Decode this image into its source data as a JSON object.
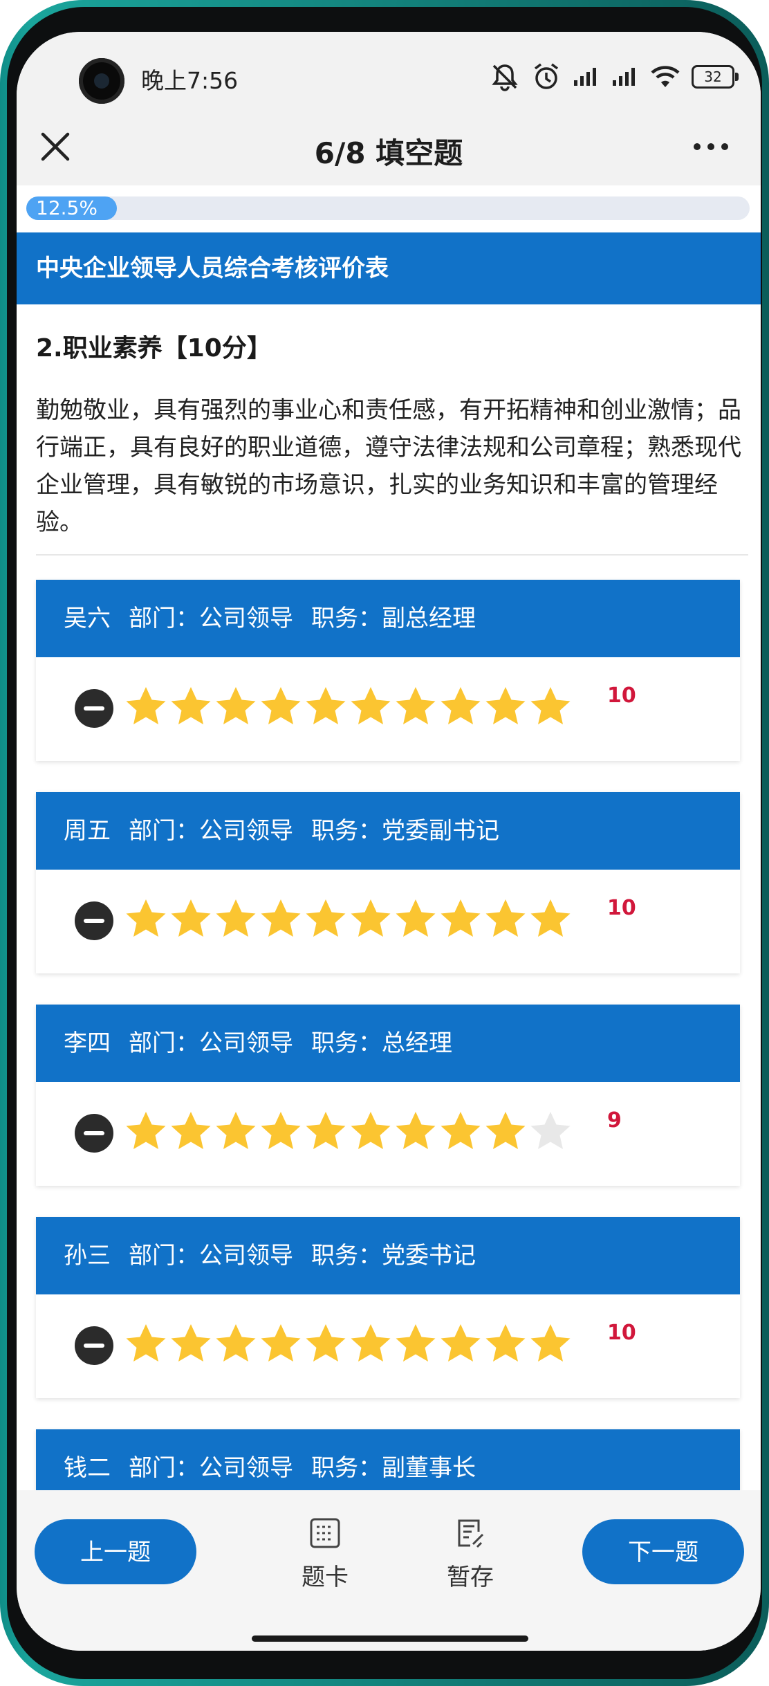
{
  "status_bar": {
    "time": "晚上7:56",
    "battery": "32",
    "icons": [
      "mute-icon",
      "alarm-icon",
      "signal-icon",
      "signal-icon",
      "wifi-icon",
      "battery-icon"
    ]
  },
  "nav": {
    "title": "6/8 填空题",
    "close_icon": "close-icon",
    "more_icon": "more-icon"
  },
  "progress": {
    "label": "12.5%",
    "value": 0.125
  },
  "section": {
    "header": "中央企业领导人员综合考核评价表"
  },
  "question": {
    "title": "2.职业素养【10分】",
    "description": "勤勉敬业，具有强烈的事业心和责任感，有开拓精神和创业激情；品行端正，具有良好的职业道德，遵守法律法规和公司章程；熟悉现代企业管理，具有敏锐的市场意识，扎实的业务知识和丰富的管理经验。"
  },
  "ratings": {
    "max_stars": 10,
    "items": [
      {
        "name": "吴六",
        "dept": "部门：公司领导",
        "role": "职务：副总经理",
        "score": 10,
        "score_label": "10"
      },
      {
        "name": "周五",
        "dept": "部门：公司领导",
        "role": "职务：党委副书记",
        "score": 10,
        "score_label": "10"
      },
      {
        "name": "李四",
        "dept": "部门：公司领导",
        "role": "职务：总经理",
        "score": 9,
        "score_label": "9"
      },
      {
        "name": "孙三",
        "dept": "部门：公司领导",
        "role": "职务：党委书记",
        "score": 10,
        "score_label": "10"
      },
      {
        "name": "钱二",
        "dept": "部门：公司领导",
        "role": "职务：副董事长"
      }
    ]
  },
  "bottom": {
    "prev_label": "上一题",
    "card_label": "题卡",
    "save_label": "暂存",
    "next_label": "下一题"
  },
  "colors": {
    "primary": "#1172c8",
    "progress": "#4ea3f3",
    "star_on": "#fbc531",
    "star_off": "#e8e8e8",
    "score": "#d1173b"
  }
}
